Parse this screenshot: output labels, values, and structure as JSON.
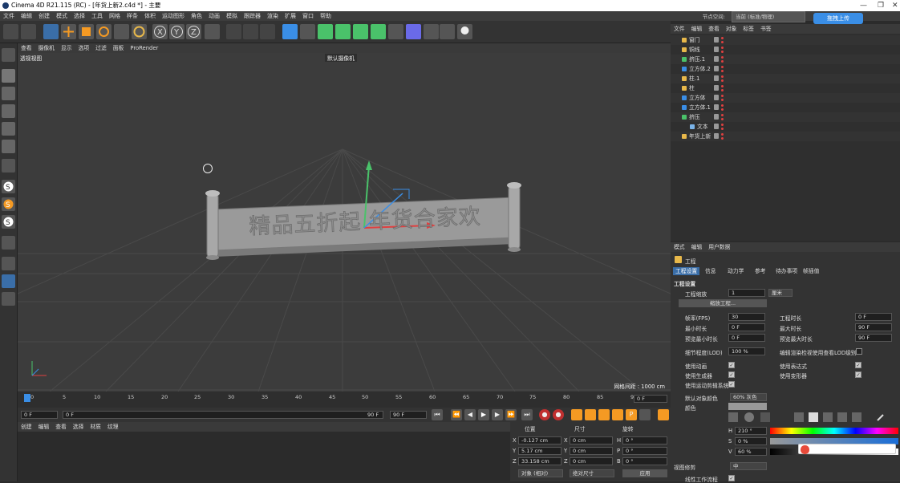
{
  "titlebar": {
    "title": "Cinema 4D R21.115 (RC) - [年货上新2.c4d *] - 主要",
    "minimize": "—",
    "maximize": "❐",
    "close": "✕"
  },
  "menubar": {
    "items": [
      "文件",
      "编辑",
      "创建",
      "模式",
      "选择",
      "工具",
      "网格",
      "样条",
      "体积",
      "运动图形",
      "角色",
      "动画",
      "模拟",
      "跟踪器",
      "渲染",
      "扩展",
      "窗口",
      "帮助"
    ],
    "layout_label": "节点空间:",
    "layout_value": "当前 (标准/物理)",
    "layout_pick": "界面:"
  },
  "upload": {
    "label": "拖拽上传"
  },
  "viewport": {
    "menu": [
      "查看",
      "摄像机",
      "显示",
      "选项",
      "过滤",
      "面板",
      "ProRender"
    ],
    "label": "透视视图",
    "camera": "默认摄像机",
    "grid_size": "网格间距 : 1000 cm",
    "sign_text": "精品五折起 年货合家欢"
  },
  "timeline": {
    "ticks": [
      "0",
      "5",
      "10",
      "15",
      "20",
      "25",
      "30",
      "35",
      "40",
      "45",
      "50",
      "55",
      "60",
      "65",
      "70",
      "75",
      "80",
      "85",
      "90"
    ],
    "end_frame": "0 F"
  },
  "transport": {
    "start": "0 F",
    "current": "0 F",
    "end_range": "90 F",
    "end": "90 F"
  },
  "materials": {
    "menu": [
      "创建",
      "编辑",
      "查看",
      "选择",
      "材质",
      "纹理"
    ]
  },
  "coords": {
    "headers": [
      "位置",
      "尺寸",
      "旋转"
    ],
    "rows": [
      {
        "axis": "X",
        "pos": "-0.127 cm",
        "size_axis": "X",
        "size": "0 cm",
        "rot_axis": "H",
        "rot": "0 °"
      },
      {
        "axis": "Y",
        "pos": "5.17 cm",
        "size_axis": "Y",
        "size": "0 cm",
        "rot_axis": "P",
        "rot": "0 °"
      },
      {
        "axis": "Z",
        "pos": "33.158 cm",
        "size_axis": "Z",
        "size": "0 cm",
        "rot_axis": "B",
        "rot": "0 °"
      }
    ],
    "mode1": "对象 (相对)",
    "mode2": "绝对尺寸",
    "apply": "应用"
  },
  "objects": {
    "menu": [
      "文件",
      "编辑",
      "查看",
      "对象",
      "标签",
      "书签"
    ],
    "items": [
      {
        "name": "窗门",
        "indent": 0,
        "icon": "#e8b84a"
      },
      {
        "name": "铜线",
        "indent": 0,
        "icon": "#e8b84a"
      },
      {
        "name": "挤压.1",
        "indent": 0,
        "icon": "#4ac26a"
      },
      {
        "name": "立方体.2",
        "indent": 0,
        "icon": "#3a8ee6"
      },
      {
        "name": "柱.1",
        "indent": 0,
        "icon": "#e8b84a"
      },
      {
        "name": "柱",
        "indent": 0,
        "icon": "#e8b84a"
      },
      {
        "name": "立方体",
        "indent": 0,
        "icon": "#3a8ee6"
      },
      {
        "name": "立方体.1",
        "indent": 0,
        "icon": "#3a8ee6"
      },
      {
        "name": "挤压",
        "indent": 0,
        "icon": "#4ac26a"
      },
      {
        "name": "文本",
        "indent": 1,
        "icon": "#7ab3e8"
      },
      {
        "name": "年货上新",
        "indent": 0,
        "icon": "#e8b84a"
      }
    ]
  },
  "attributes": {
    "menu": [
      "模式",
      "编辑",
      "用户数据"
    ],
    "section": "工程",
    "tabs": [
      "工程设置",
      "信息",
      "动力学",
      "参考",
      "待办事项",
      "帧插值"
    ],
    "heading": "工程设置",
    "scale_label": "工程缩放",
    "scale_value": "1",
    "scale_unit": "厘米",
    "scale_button": "缩放工程...",
    "fps_label": "帧率(FPS)",
    "fps_value": "30",
    "duration_label": "工程时长",
    "duration_value": "0 F",
    "min_label": "最小时长",
    "min_value": "0 F",
    "max_label": "最大时长",
    "max_value": "90 F",
    "pmin_label": "预览最小时长",
    "pmin_value": "0 F",
    "pmax_label": "预览最大时长",
    "pmax_value": "90 F",
    "lod_label": "细节程度(LOD)",
    "lod_value": "100 %",
    "lod_check": "编辑渲染检视使用查看LOD级别",
    "use_anim": "使用动画",
    "use_expr": "使用表达式",
    "use_gen": "使用生成器",
    "use_deform": "使用变形器",
    "use_motion": "使用运动剪辑系统",
    "default_color_label": "默认对象颜色",
    "default_color_value": "60% 灰色",
    "color_label": "颜色",
    "h_label": "H",
    "h_value": "210 °",
    "s_label": "S",
    "s_value": "0 %",
    "v_label": "V",
    "v_value": "60 %",
    "view_clip_label": "视图修剪",
    "view_clip_value": "中",
    "linear_label": "线性工作流程"
  },
  "colors": {
    "accent": "#3a8ee6",
    "panel": "#333333",
    "viewport": "#3c3c3c",
    "sign": "#a8a8a8"
  }
}
